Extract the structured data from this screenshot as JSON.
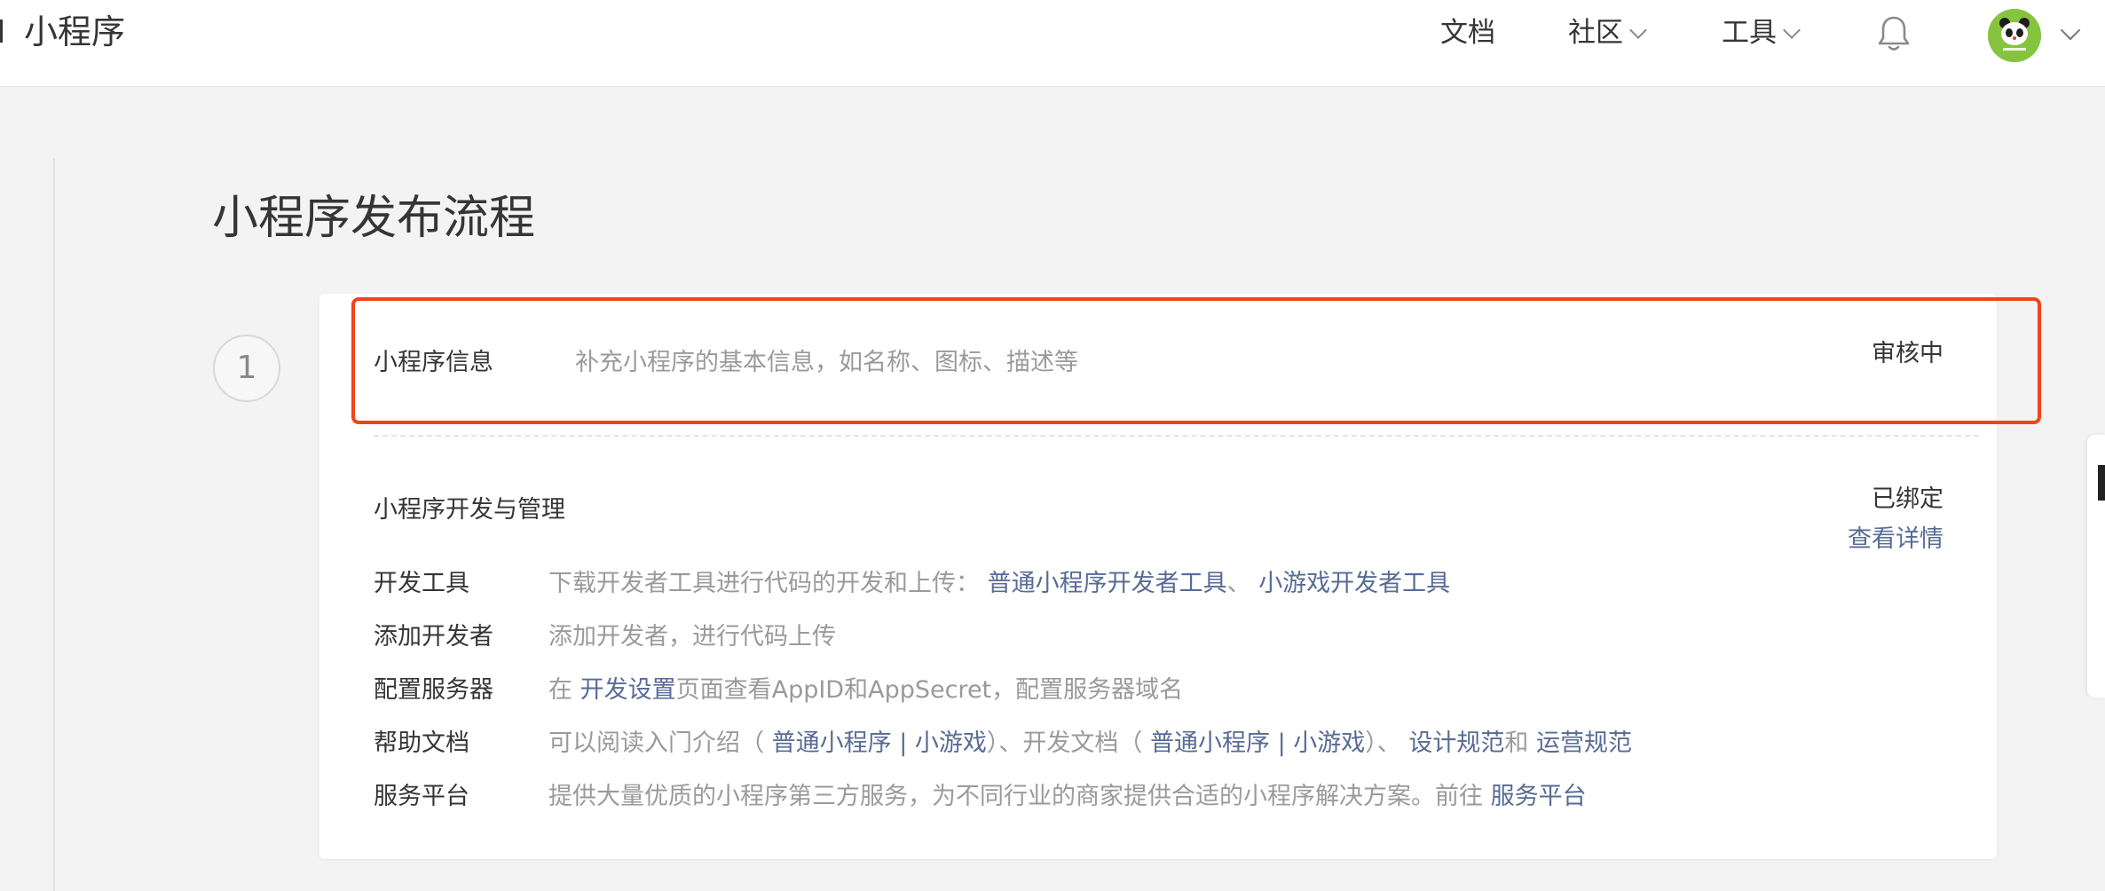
{
  "header": {
    "app_title": "小程序",
    "nav": {
      "docs": "文档",
      "community": "社区",
      "tools": "工具"
    },
    "icons": [
      "bell-icon",
      "avatar",
      "chevron-down-icon"
    ]
  },
  "page": {
    "title": "小程序发布流程",
    "step_number": "1"
  },
  "info": {
    "label": "小程序信息",
    "description": "补充小程序的基本信息，如名称、图标、描述等",
    "status": "审核中"
  },
  "dev": {
    "title": "小程序开发与管理",
    "status": "已绑定",
    "details_link": "查看详情",
    "rows": [
      {
        "key": "开发工具",
        "text": "下载开发者工具进行代码的开发和上传：",
        "link1": "普通小程序开发者工具",
        "sep": "、",
        "link2": "小游戏开发者工具"
      },
      {
        "key": "添加开发者",
        "text": "添加开发者，进行代码上传"
      },
      {
        "key": "配置服务器",
        "prefix": "在",
        "link": "开发设置",
        "text": "页面查看AppID和AppSecret，配置服务器域名"
      },
      {
        "key": "帮助文档",
        "prefix": "可以阅读入门介绍（",
        "link1": "普通小程序",
        "bar": "|",
        "link2": "小游戏",
        "mid": "）、开发文档（",
        "link3": "普通小程序",
        "link4": "小游戏",
        "end": "）、",
        "link5": "设计规范",
        "and": "和",
        "link6": "运营规范"
      },
      {
        "key": "服务平台",
        "text": "提供大量优质的小程序第三方服务，为不同行业的商家提供合适的小程序解决方案。前往",
        "link": "服务平台"
      }
    ]
  },
  "colors": {
    "link": "#576b95",
    "highlight_border": "#f0441c",
    "muted_text": "#9a9a9a"
  }
}
